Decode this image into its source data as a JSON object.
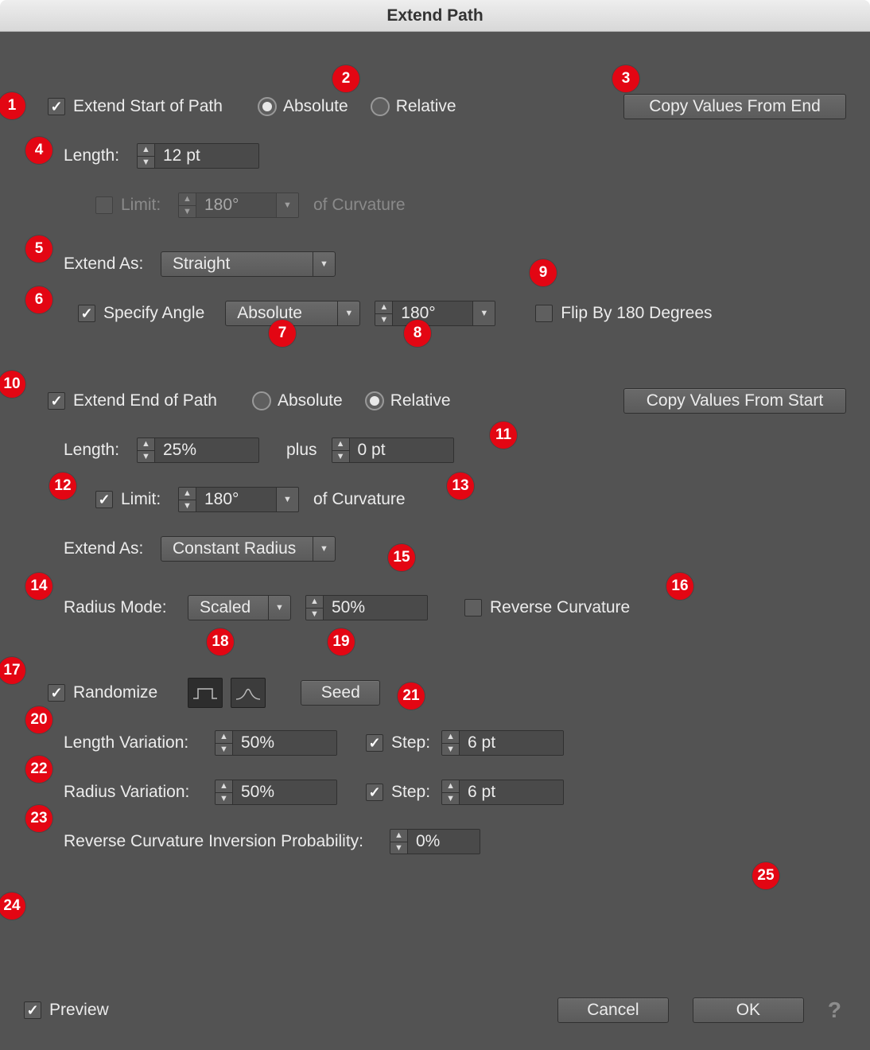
{
  "title": "Extend Path",
  "start": {
    "enable_label": "Extend Start of Path",
    "enabled": true,
    "mode_abs": "Absolute",
    "mode_rel": "Relative",
    "mode": "Absolute",
    "copy_btn": "Copy Values From End",
    "length_label": "Length:",
    "length_value": "12 pt",
    "limit_label": "Limit:",
    "limit_enabled": false,
    "limit_value": "180°",
    "limit_suffix": "of Curvature",
    "extend_as_label": "Extend As:",
    "extend_as_value": "Straight",
    "specify_angle_label": "Specify Angle",
    "specify_angle_enabled": true,
    "angle_mode_value": "Absolute",
    "angle_value": "180°",
    "flip_label": "Flip By 180 Degrees",
    "flip_enabled": false
  },
  "end": {
    "enable_label": "Extend End of Path",
    "enabled": true,
    "mode_abs": "Absolute",
    "mode_rel": "Relative",
    "mode": "Relative",
    "copy_btn": "Copy Values From Start",
    "length_label": "Length:",
    "length_value": "25%",
    "plus_label": "plus",
    "plus_value": "0 pt",
    "limit_label": "Limit:",
    "limit_enabled": true,
    "limit_value": "180°",
    "limit_suffix": "of Curvature",
    "extend_as_label": "Extend As:",
    "extend_as_value": "Constant Radius",
    "radius_mode_label": "Radius Mode:",
    "radius_mode_value": "Scaled",
    "radius_scale_value": "50%",
    "reverse_curv_label": "Reverse Curvature",
    "reverse_curv_enabled": false
  },
  "random": {
    "enable_label": "Randomize",
    "enabled": true,
    "seed_btn": "Seed",
    "length_var_label": "Length Variation:",
    "length_var_value": "50%",
    "length_step_label": "Step:",
    "length_step_enabled": true,
    "length_step_value": "6 pt",
    "radius_var_label": "Radius Variation:",
    "radius_var_value": "50%",
    "radius_step_label": "Step:",
    "radius_step_enabled": true,
    "radius_step_value": "6 pt",
    "inversion_label": "Reverse Curvature Inversion Probability:",
    "inversion_value": "0%"
  },
  "footer": {
    "preview_label": "Preview",
    "preview": true,
    "cancel": "Cancel",
    "ok": "OK",
    "help": "?"
  },
  "annotations": [
    1,
    2,
    3,
    4,
    5,
    6,
    7,
    8,
    9,
    10,
    11,
    12,
    13,
    14,
    15,
    16,
    17,
    18,
    19,
    20,
    21,
    22,
    23,
    24,
    25
  ]
}
